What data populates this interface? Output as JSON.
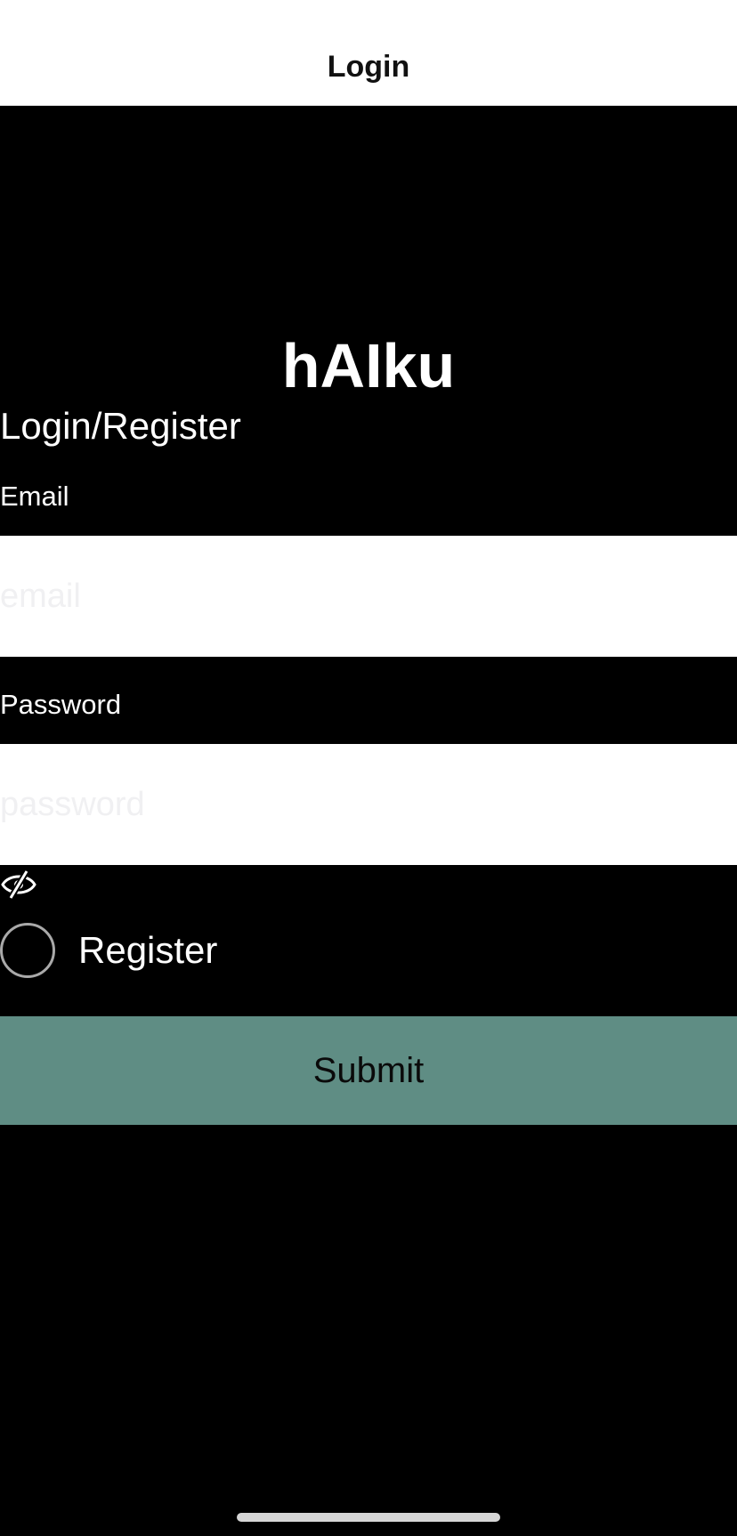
{
  "nav": {
    "title": "Login"
  },
  "app": {
    "title": "hAIku"
  },
  "form": {
    "heading": "Login/Register",
    "email_label": "Email",
    "email_placeholder": "email",
    "email_value": "",
    "password_label": "Password",
    "password_placeholder": "password",
    "password_value": "",
    "password_visibility_icon": "eye-slash-icon",
    "register_label": "Register",
    "register_checked": false,
    "submit_label": "Submit"
  },
  "colors": {
    "background": "#000000",
    "nav_background": "#ffffff",
    "submit_background": "#5f8d84",
    "text": "#ffffff"
  }
}
